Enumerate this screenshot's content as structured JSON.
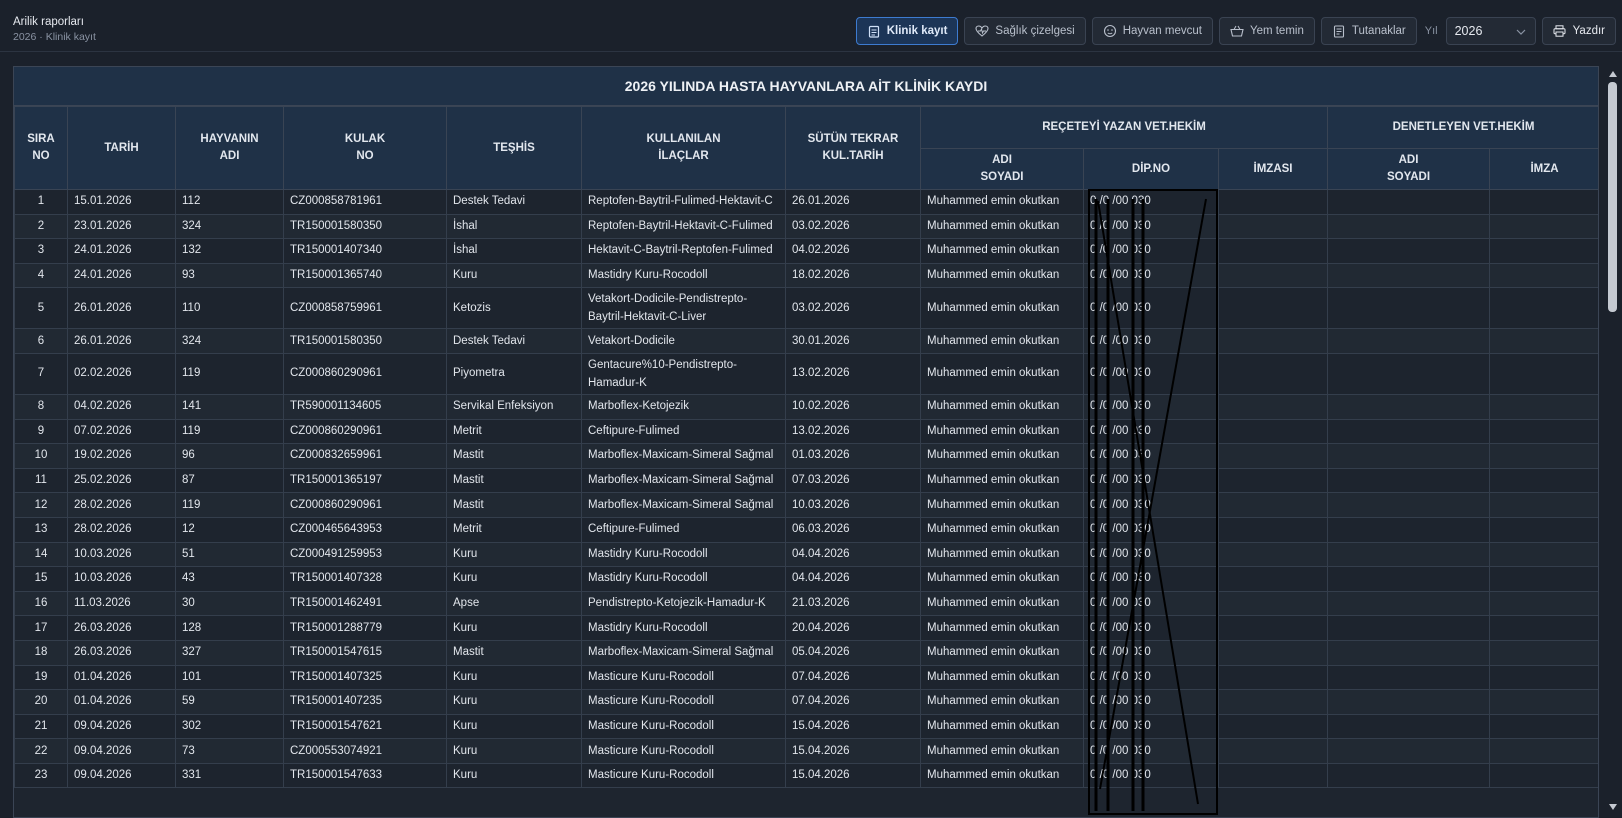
{
  "header": {
    "title": "Arilik raporları",
    "subtitle": "2026 · Klinik kayıt"
  },
  "toolbar": {
    "tabs": [
      {
        "label": "Klinik kayıt",
        "icon": "clipboard-icon",
        "active": true
      },
      {
        "label": "Sağlık çizelgesi",
        "icon": "heart-pulse-icon",
        "active": false
      },
      {
        "label": "Hayvan mevcut",
        "icon": "cow-icon",
        "active": false
      },
      {
        "label": "Yem temin",
        "icon": "basket-icon",
        "active": false
      },
      {
        "label": "Tutanaklar",
        "icon": "document-icon",
        "active": false
      }
    ],
    "year_label": "Yıl",
    "year_value": "2026",
    "print_label": "Yazdır"
  },
  "colors": {
    "accent": "#3d7bd0",
    "header_bg": "#1f3147",
    "page_bg": "#1b212b"
  },
  "table": {
    "title": "2026 YILINDA HASTA HAYVANLARA AİT KLİNİK KAYDI",
    "headers": {
      "sira": "SIRA NO",
      "tarih": "TARİH",
      "hayvan": "HAYVANIN ADI",
      "kulak": "KULAK NO",
      "teshis": "TEŞHİS",
      "ilac": "KULLANILAN İLAÇLAR",
      "sutun": "SÜTÜN TEKRAR KUL.TARİH",
      "recete_group": "REÇETEYİ YAZAN VET.HEKİM",
      "recete_ad": "ADI SOYADI",
      "recete_dip": "DİP.NO",
      "recete_imza": "İMZASI",
      "denet_group": "DENETLEYEN VET.HEKİM",
      "denet_ad": "ADI SOYADI",
      "denet_imza": "İMZA"
    },
    "rows": [
      {
        "no": "1",
        "tarih": "15.01.2026",
        "hayvan": "112",
        "kulak": "CZ000858781961",
        "teshis": "Destek Tedavi",
        "ilac": "Reptofen-Baytril-Fulimed-Hektavit-C",
        "sutun": "26.01.2026",
        "vet": "Muhammed emin okutkan",
        "dip": "0 /0 /00 030"
      },
      {
        "no": "2",
        "tarih": "23.01.2026",
        "hayvan": "324",
        "kulak": "TR150001580350",
        "teshis": "İshal",
        "ilac": "Reptofen-Baytril-Hektavit-C-Fulimed",
        "sutun": "03.02.2026",
        "vet": "Muhammed emin okutkan",
        "dip": "0 /0 /00 030"
      },
      {
        "no": "3",
        "tarih": "24.01.2026",
        "hayvan": "132",
        "kulak": "TR150001407340",
        "teshis": "İshal",
        "ilac": "Hektavit-C-Baytril-Reptofen-Fulimed",
        "sutun": "04.02.2026",
        "vet": "Muhammed emin okutkan",
        "dip": "0 /0 /00 030"
      },
      {
        "no": "4",
        "tarih": "24.01.2026",
        "hayvan": "93",
        "kulak": "TR150001365740",
        "teshis": "Kuru",
        "ilac": "Mastidry Kuru-Rocodoll",
        "sutun": "18.02.2026",
        "vet": "Muhammed emin okutkan",
        "dip": "0 /0 /00 030"
      },
      {
        "no": "5",
        "tarih": "26.01.2026",
        "hayvan": "110",
        "kulak": "CZ000858759961",
        "teshis": "Ketozis",
        "ilac": "Vetakort-Dodicile-Pendistrepto-Baytril-Hektavit-C-Liver",
        "sutun": "03.02.2026",
        "vet": "Muhammed emin okutkan",
        "dip": "0 /0 /00 030"
      },
      {
        "no": "6",
        "tarih": "26.01.2026",
        "hayvan": "324",
        "kulak": "TR150001580350",
        "teshis": "Destek Tedavi",
        "ilac": "Vetakort-Dodicile",
        "sutun": "30.01.2026",
        "vet": "Muhammed emin okutkan",
        "dip": "0 /0 /00 030"
      },
      {
        "no": "7",
        "tarih": "02.02.2026",
        "hayvan": "119",
        "kulak": "CZ000860290961",
        "teshis": "Piyometra",
        "ilac": "Gentacure%10-Pendistrepto-Hamadur-K",
        "sutun": "13.02.2026",
        "vet": "Muhammed emin okutkan",
        "dip": "0 /0 /00 030"
      },
      {
        "no": "8",
        "tarih": "04.02.2026",
        "hayvan": "141",
        "kulak": "TR590001134605",
        "teshis": "Servikal Enfeksiyon",
        "ilac": "Marboflex-Ketojezik",
        "sutun": "10.02.2026",
        "vet": "Muhammed emin okutkan",
        "dip": "0 /0 /00 030"
      },
      {
        "no": "9",
        "tarih": "07.02.2026",
        "hayvan": "119",
        "kulak": "CZ000860290961",
        "teshis": "Metrit",
        "ilac": "Ceftipure-Fulimed",
        "sutun": "13.02.2026",
        "vet": "Muhammed emin okutkan",
        "dip": "0 /0 /00 030"
      },
      {
        "no": "10",
        "tarih": "19.02.2026",
        "hayvan": "96",
        "kulak": "CZ000832659961",
        "teshis": "Mastit",
        "ilac": "Marboflex-Maxicam-Simeral Sağmal",
        "sutun": "01.03.2026",
        "vet": "Muhammed emin okutkan",
        "dip": "0 /0 /00 030"
      },
      {
        "no": "11",
        "tarih": "25.02.2026",
        "hayvan": "87",
        "kulak": "TR150001365197",
        "teshis": "Mastit",
        "ilac": "Marboflex-Maxicam-Simeral Sağmal",
        "sutun": "07.03.2026",
        "vet": "Muhammed emin okutkan",
        "dip": "0 /0 /00 030"
      },
      {
        "no": "12",
        "tarih": "28.02.2026",
        "hayvan": "119",
        "kulak": "CZ000860290961",
        "teshis": "Mastit",
        "ilac": "Marboflex-Maxicam-Simeral Sağmal",
        "sutun": "10.03.2026",
        "vet": "Muhammed emin okutkan",
        "dip": "0 /0 /00 030"
      },
      {
        "no": "13",
        "tarih": "28.02.2026",
        "hayvan": "12",
        "kulak": "CZ000465643953",
        "teshis": "Metrit",
        "ilac": "Ceftipure-Fulimed",
        "sutun": "06.03.2026",
        "vet": "Muhammed emin okutkan",
        "dip": "0 /0 /00 030"
      },
      {
        "no": "14",
        "tarih": "10.03.2026",
        "hayvan": "51",
        "kulak": "CZ000491259953",
        "teshis": "Kuru",
        "ilac": "Mastidry Kuru-Rocodoll",
        "sutun": "04.04.2026",
        "vet": "Muhammed emin okutkan",
        "dip": "0 /0 /00 030"
      },
      {
        "no": "15",
        "tarih": "10.03.2026",
        "hayvan": "43",
        "kulak": "TR150001407328",
        "teshis": "Kuru",
        "ilac": "Mastidry Kuru-Rocodoll",
        "sutun": "04.04.2026",
        "vet": "Muhammed emin okutkan",
        "dip": "0 /0 /00 030"
      },
      {
        "no": "16",
        "tarih": "11.03.2026",
        "hayvan": "30",
        "kulak": "TR150001462491",
        "teshis": "Apse",
        "ilac": "Pendistrepto-Ketojezik-Hamadur-K",
        "sutun": "21.03.2026",
        "vet": "Muhammed emin okutkan",
        "dip": "0 /0 /00 030"
      },
      {
        "no": "17",
        "tarih": "26.03.2026",
        "hayvan": "128",
        "kulak": "TR150001288779",
        "teshis": "Kuru",
        "ilac": "Mastidry Kuru-Rocodoll",
        "sutun": "20.04.2026",
        "vet": "Muhammed emin okutkan",
        "dip": "0 /0 /00 030"
      },
      {
        "no": "18",
        "tarih": "26.03.2026",
        "hayvan": "327",
        "kulak": "TR150001547615",
        "teshis": "Mastit",
        "ilac": "Marboflex-Maxicam-Simeral Sağmal",
        "sutun": "05.04.2026",
        "vet": "Muhammed emin okutkan",
        "dip": "0 /0 /00 030"
      },
      {
        "no": "19",
        "tarih": "01.04.2026",
        "hayvan": "101",
        "kulak": "TR150001407325",
        "teshis": "Kuru",
        "ilac": "Masticure Kuru-Rocodoll",
        "sutun": "07.04.2026",
        "vet": "Muhammed emin okutkan",
        "dip": "0 /0 /00 030"
      },
      {
        "no": "20",
        "tarih": "01.04.2026",
        "hayvan": "59",
        "kulak": "TR150001407235",
        "teshis": "Kuru",
        "ilac": "Masticure Kuru-Rocodoll",
        "sutun": "07.04.2026",
        "vet": "Muhammed emin okutkan",
        "dip": "0 /0 /00 030"
      },
      {
        "no": "21",
        "tarih": "09.04.2026",
        "hayvan": "302",
        "kulak": "TR150001547621",
        "teshis": "Kuru",
        "ilac": "Masticure Kuru-Rocodoll",
        "sutun": "15.04.2026",
        "vet": "Muhammed emin okutkan",
        "dip": "0 /0 /00 030"
      },
      {
        "no": "22",
        "tarih": "09.04.2026",
        "hayvan": "73",
        "kulak": "CZ000553074921",
        "teshis": "Kuru",
        "ilac": "Masticure Kuru-Rocodoll",
        "sutun": "15.04.2026",
        "vet": "Muhammed emin okutkan",
        "dip": "0 /0 /00 030"
      },
      {
        "no": "23",
        "tarih": "09.04.2026",
        "hayvan": "331",
        "kulak": "TR150001547633",
        "teshis": "Kuru",
        "ilac": "Masticure Kuru-Rocodoll",
        "sutun": "15.04.2026",
        "vet": "Muhammed emin okutkan",
        "dip": "0 /0 /00 030"
      }
    ]
  }
}
